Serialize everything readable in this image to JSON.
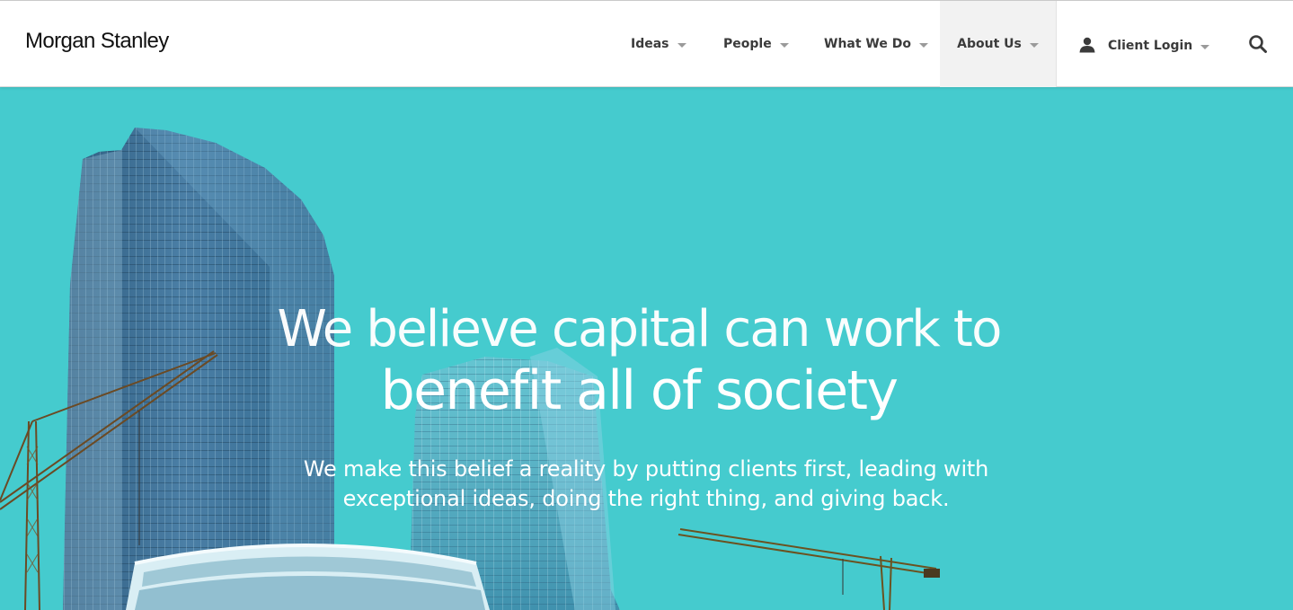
{
  "header": {
    "logo_text": "Morgan Stanley",
    "nav": [
      {
        "label": "Ideas"
      },
      {
        "label": "People"
      },
      {
        "label": "What We Do"
      },
      {
        "label": "About Us",
        "active": true
      }
    ],
    "login_label": "Client Login",
    "icons": {
      "login": "user-icon",
      "search": "search-icon",
      "dropdown": "caret-down-icon"
    }
  },
  "hero": {
    "headline_line1": "We believe capital can work to",
    "headline_line2": "benefit all of society",
    "sub_line1": "We make this belief a reality by putting clients first, leading with",
    "sub_line2": "exceptional ideas, doing the right thing, and giving back.",
    "image_subject": "glass-skyscrapers-with-construction-cranes"
  },
  "colors": {
    "hero_background": "#45cbce",
    "nav_text": "#3b3b3b",
    "active_nav_background": "#f2f2f2",
    "logo_text": "#111111"
  }
}
